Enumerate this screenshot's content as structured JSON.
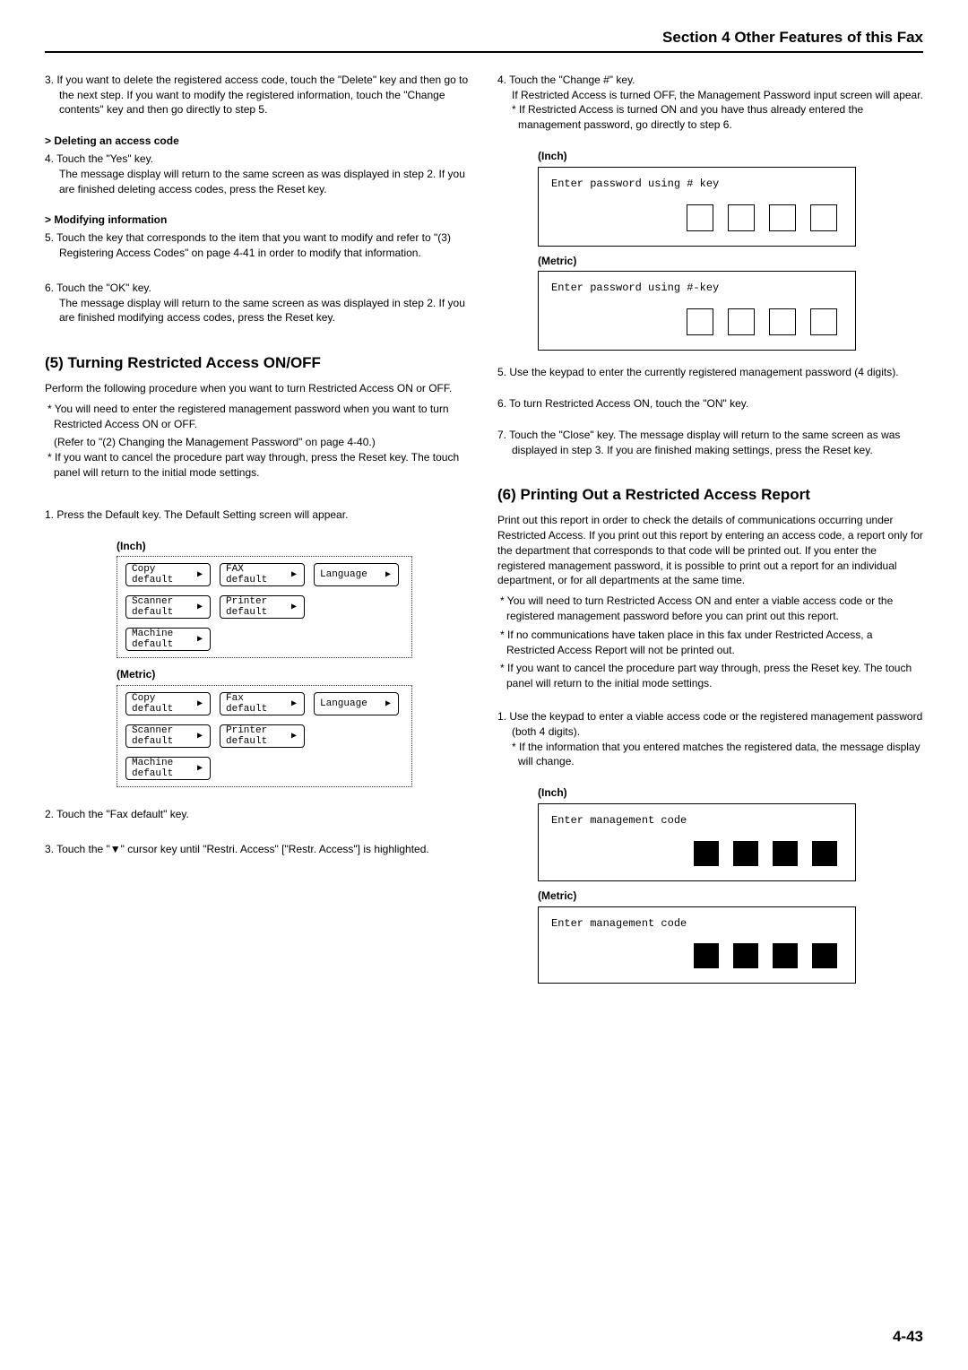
{
  "header": "Section 4 Other Features of this Fax",
  "left": {
    "step3": "3. If you want to delete the registered access code, touch the \"Delete\" key and then go to the next step. If you want to modify the registered information, touch the \"Change contents\" key and then go directly to step 5.",
    "deleteHeading": "> Deleting an access code",
    "step4": "4. Touch the \"Yes\" key.",
    "step4sub": "The message display will return to the same screen as was displayed in step 2. If you are finished deleting access codes, press the Reset key.",
    "modifyHeading": "> Modifying information",
    "step5": "5. Touch the key that corresponds to the item that you want to modify and refer to \"(3) Registering Access Codes\" on page 4-41 in order to modify that information.",
    "step6": "6. Touch the \"OK\" key.",
    "step6sub": "The message display will return to the same screen as was displayed in step 2. If you are finished modifying access codes, press the Reset key.",
    "title5": "(5) Turning Restricted Access ON/OFF",
    "intro5": "Perform the following procedure when you want to turn Restricted Access ON or OFF.",
    "note5a": "* You will need to enter the registered management password when you want to turn Restricted Access ON or OFF.",
    "note5aSub": "(Refer to \"(2) Changing the Management Password\" on page 4-40.)",
    "note5b": "* If you want to cancel the procedure part way through, press the Reset key. The touch panel will return to the initial mode settings.",
    "s5step1": "1. Press the Default key. The Default Setting screen will appear.",
    "inchLabel": "(Inch)",
    "metricLabel": "(Metric)",
    "btns": {
      "copy": "Copy\ndefault",
      "fax": "FAX\ndefault",
      "faxM": "Fax\ndefault",
      "scanner": "Scanner\ndefault",
      "printer": "Printer\ndefault",
      "machine": "Machine\ndefault",
      "language": "Language"
    },
    "s5step2": "2. Touch the \"Fax default\" key.",
    "s5step3": "3. Touch the \"▼\" cursor key until \"Restri. Access\" [\"Restr. Access\"] is highlighted."
  },
  "right": {
    "step4": "4. Touch the \"Change #\" key.",
    "step4a": "If Restricted Access is turned OFF, the Management Password input screen will apear.",
    "step4b": "* If Restricted Access is turned ON and you have thus already entered the management password, go directly to step 6.",
    "inchLabel": "(Inch)",
    "promptInch": "Enter password using # key",
    "metricLabel": "(Metric)",
    "promptMetric": "Enter password using #-key",
    "step5": "5. Use the keypad to enter the currently registered management password (4 digits).",
    "step6": "6. To turn Restricted Access ON, touch the \"ON\" key.",
    "step7": "7. Touch the \"Close\" key. The message display will return to the same screen as was displayed in step 3. If you are finished making settings, press the Reset key.",
    "title6": "(6) Printing Out a Restricted Access Report",
    "intro6": "Print out this report in order to check the details of communications occurring under Restricted Access. If you print out this report by entering an access code, a report only for the department that corresponds to that code will be printed out. If you enter the registered management password, it is possible to print out a report for an individual department, or for all departments at the same time.",
    "note6a": "* You will need to turn Restricted Access ON and enter  a viable access code or the registered management password before you can print out this report.",
    "note6b": "* If no communications have taken place in this fax under Restricted Access, a Restricted Access Report will not be printed out.",
    "note6c": "* If you want to cancel the procedure part way through, press the Reset key. The touch panel will return to the initial mode settings.",
    "s6step1": "1. Use the keypad to enter a viable access code or the registered management password (both 4 digits).",
    "s6step1sub": "* If the information that you entered matches the registered data, the message display will change.",
    "mgmtPrompt": "Enter management code"
  },
  "pageNum": "4-43"
}
